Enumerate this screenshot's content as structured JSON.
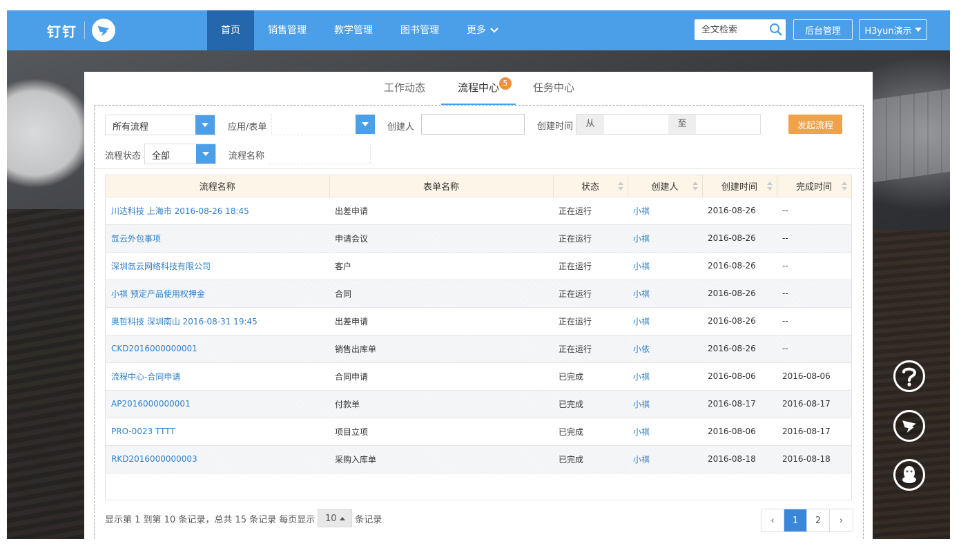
{
  "topbar": {
    "logo_text": "钉钉",
    "nav": [
      {
        "label": "首页",
        "active": true
      },
      {
        "label": "销售管理",
        "active": false
      },
      {
        "label": "教学管理",
        "active": false
      },
      {
        "label": "图书管理",
        "active": false
      },
      {
        "label": "更多",
        "active": false
      }
    ],
    "search_placeholder": "全文检索",
    "admin_label": "后台管理",
    "user_label": "H3yun演示"
  },
  "tabs": [
    {
      "label": "工作动态",
      "active": false
    },
    {
      "label": "流程中心",
      "active": true,
      "badge": "5"
    },
    {
      "label": "任务中心",
      "active": false
    }
  ],
  "filters": {
    "process_select": "所有流程",
    "app_form_label": "应用/表单",
    "creator_label": "创建人",
    "created_time_label": "创建时间",
    "from_label": "从",
    "to_label": "至",
    "start_button": "发起流程",
    "status_label": "流程状态",
    "status_select": "全部",
    "process_name_label": "流程名称"
  },
  "table": {
    "headers": [
      "流程名称",
      "表单名称",
      "状态",
      "创建人",
      "创建时间",
      "完成时间"
    ],
    "rows": [
      [
        "川达科技 上海市 2016-08-26 18:45",
        "出差申请",
        "正在运行",
        "小祺",
        "2016-08-26",
        "--"
      ],
      [
        "氙云外包事项",
        "申请会议",
        "正在运行",
        "小祺",
        "2016-08-26",
        "--"
      ],
      [
        "深圳氙云网络科技有限公司",
        "客户",
        "正在运行",
        "小祺",
        "2016-08-26",
        "--"
      ],
      [
        "小祺 预定产品使用权押金",
        "合同",
        "正在运行",
        "小祺",
        "2016-08-26",
        "--"
      ],
      [
        "奥哲科技 深圳南山 2016-08-31 19:45",
        "出差申请",
        "正在运行",
        "小祺",
        "2016-08-26",
        "--"
      ],
      [
        "CKD2016000000001",
        "销售出库单",
        "正在运行",
        "小依",
        "2016-08-26",
        "--"
      ],
      [
        "流程中心-合同申请",
        "合同申请",
        "已完成",
        "小祺",
        "2016-08-06",
        "2016-08-06"
      ],
      [
        "AP2016000000001",
        "付款单",
        "已完成",
        "小祺",
        "2016-08-17",
        "2016-08-17"
      ],
      [
        "PRO-0023 TTTT",
        "项目立项",
        "已完成",
        "小祺",
        "2016-08-06",
        "2016-08-17"
      ],
      [
        "RKD2016000000003",
        "采购入库单",
        "已完成",
        "小祺",
        "2016-08-18",
        "2016-08-18"
      ]
    ]
  },
  "pager": {
    "info_prefix": "显示第 1 到第 10 条记录，总共 15 条记录 每页显示",
    "page_size": "10",
    "info_suffix": "条记录",
    "prev": "‹",
    "pages": [
      "1",
      "2"
    ],
    "next": "›",
    "current": "1"
  },
  "icons": {
    "search": "search-icon",
    "help": "question-icon",
    "dingtalk": "dingtalk-icon",
    "qq": "qq-icon"
  },
  "colors": {
    "brand_blue": "#4a9fe8",
    "nav_active": "#2567ad",
    "start_button": "#f0a24b",
    "link": "#2f7fc8",
    "badge": "#f08f3c"
  }
}
